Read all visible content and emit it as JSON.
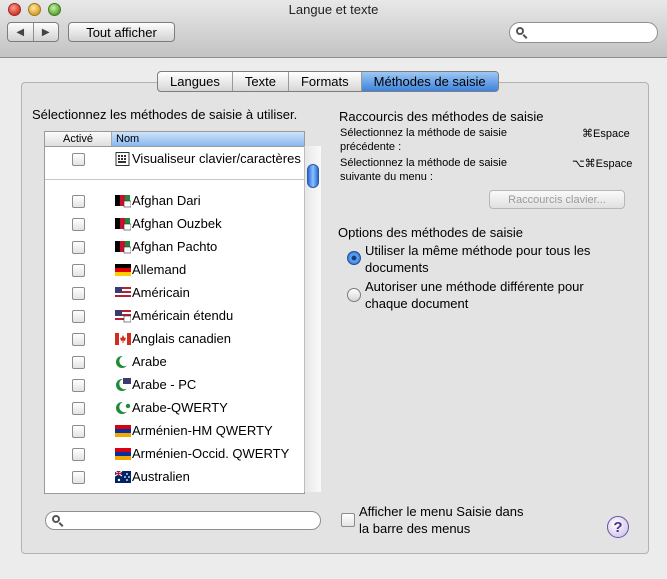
{
  "window": {
    "title": "Langue et texte"
  },
  "toolbar": {
    "back_glyph": "◀",
    "forward_glyph": "▶",
    "show_all": "Tout afficher",
    "search_placeholder": ""
  },
  "tabs": [
    {
      "label": "Langues",
      "active": false
    },
    {
      "label": "Texte",
      "active": false
    },
    {
      "label": "Formats",
      "active": false
    },
    {
      "label": "Méthodes de saisie",
      "active": true
    }
  ],
  "left": {
    "heading": "Sélectionnez les méthodes de saisie à utiliser.",
    "col_active": "Activé",
    "col_name": "Nom",
    "viewer": {
      "label": "Visualiseur clavier/caractères",
      "icon": "keyboard-viewer-icon"
    },
    "items": [
      {
        "label": "Afghan Dari",
        "icon": "afghanistan-flag-icon"
      },
      {
        "label": "Afghan Ouzbek",
        "icon": "afghanistan-flag-icon"
      },
      {
        "label": "Afghan Pachto",
        "icon": "afghanistan-flag-icon"
      },
      {
        "label": "Allemand",
        "icon": "germany-flag-icon"
      },
      {
        "label": "Américain",
        "icon": "usa-flag-icon"
      },
      {
        "label": "Américain étendu",
        "icon": "usa-flag-icon"
      },
      {
        "label": "Anglais canadien",
        "icon": "canada-flag-icon"
      },
      {
        "label": "Arabe",
        "icon": "crescent-icon"
      },
      {
        "label": "Arabe - PC",
        "icon": "crescent-icon"
      },
      {
        "label": "Arabe-QWERTY",
        "icon": "crescent-icon"
      },
      {
        "label": "Arménien-HM QWERTY",
        "icon": "armenia-flag-icon"
      },
      {
        "label": "Arménien-Occid. QWERTY",
        "icon": "armenia-flag-icon"
      },
      {
        "label": "Australien",
        "icon": "australia-flag-icon"
      }
    ]
  },
  "shortcuts": {
    "heading": "Raccourcis des méthodes de saisie",
    "prev_line1": "Sélectionnez la méthode de saisie",
    "prev_line2": "précédente :",
    "prev_key": "⌘Espace",
    "next_line1": "Sélectionnez la méthode de saisie",
    "next_line2": "suivante du menu :",
    "next_key": "⌥⌘Espace",
    "button": "Raccourcis clavier..."
  },
  "options": {
    "heading": "Options des méthodes de saisie",
    "radio1_line1": "Utiliser la même méthode pour tous les",
    "radio1_line2": "documents",
    "radio2_line1": "Autoriser une méthode différente pour",
    "radio2_line2": "chaque document",
    "selected": 1
  },
  "footer": {
    "show_menu_line1": "Afficher le menu Saisie dans",
    "show_menu_line2": "la barre des menus",
    "help": "?"
  }
}
